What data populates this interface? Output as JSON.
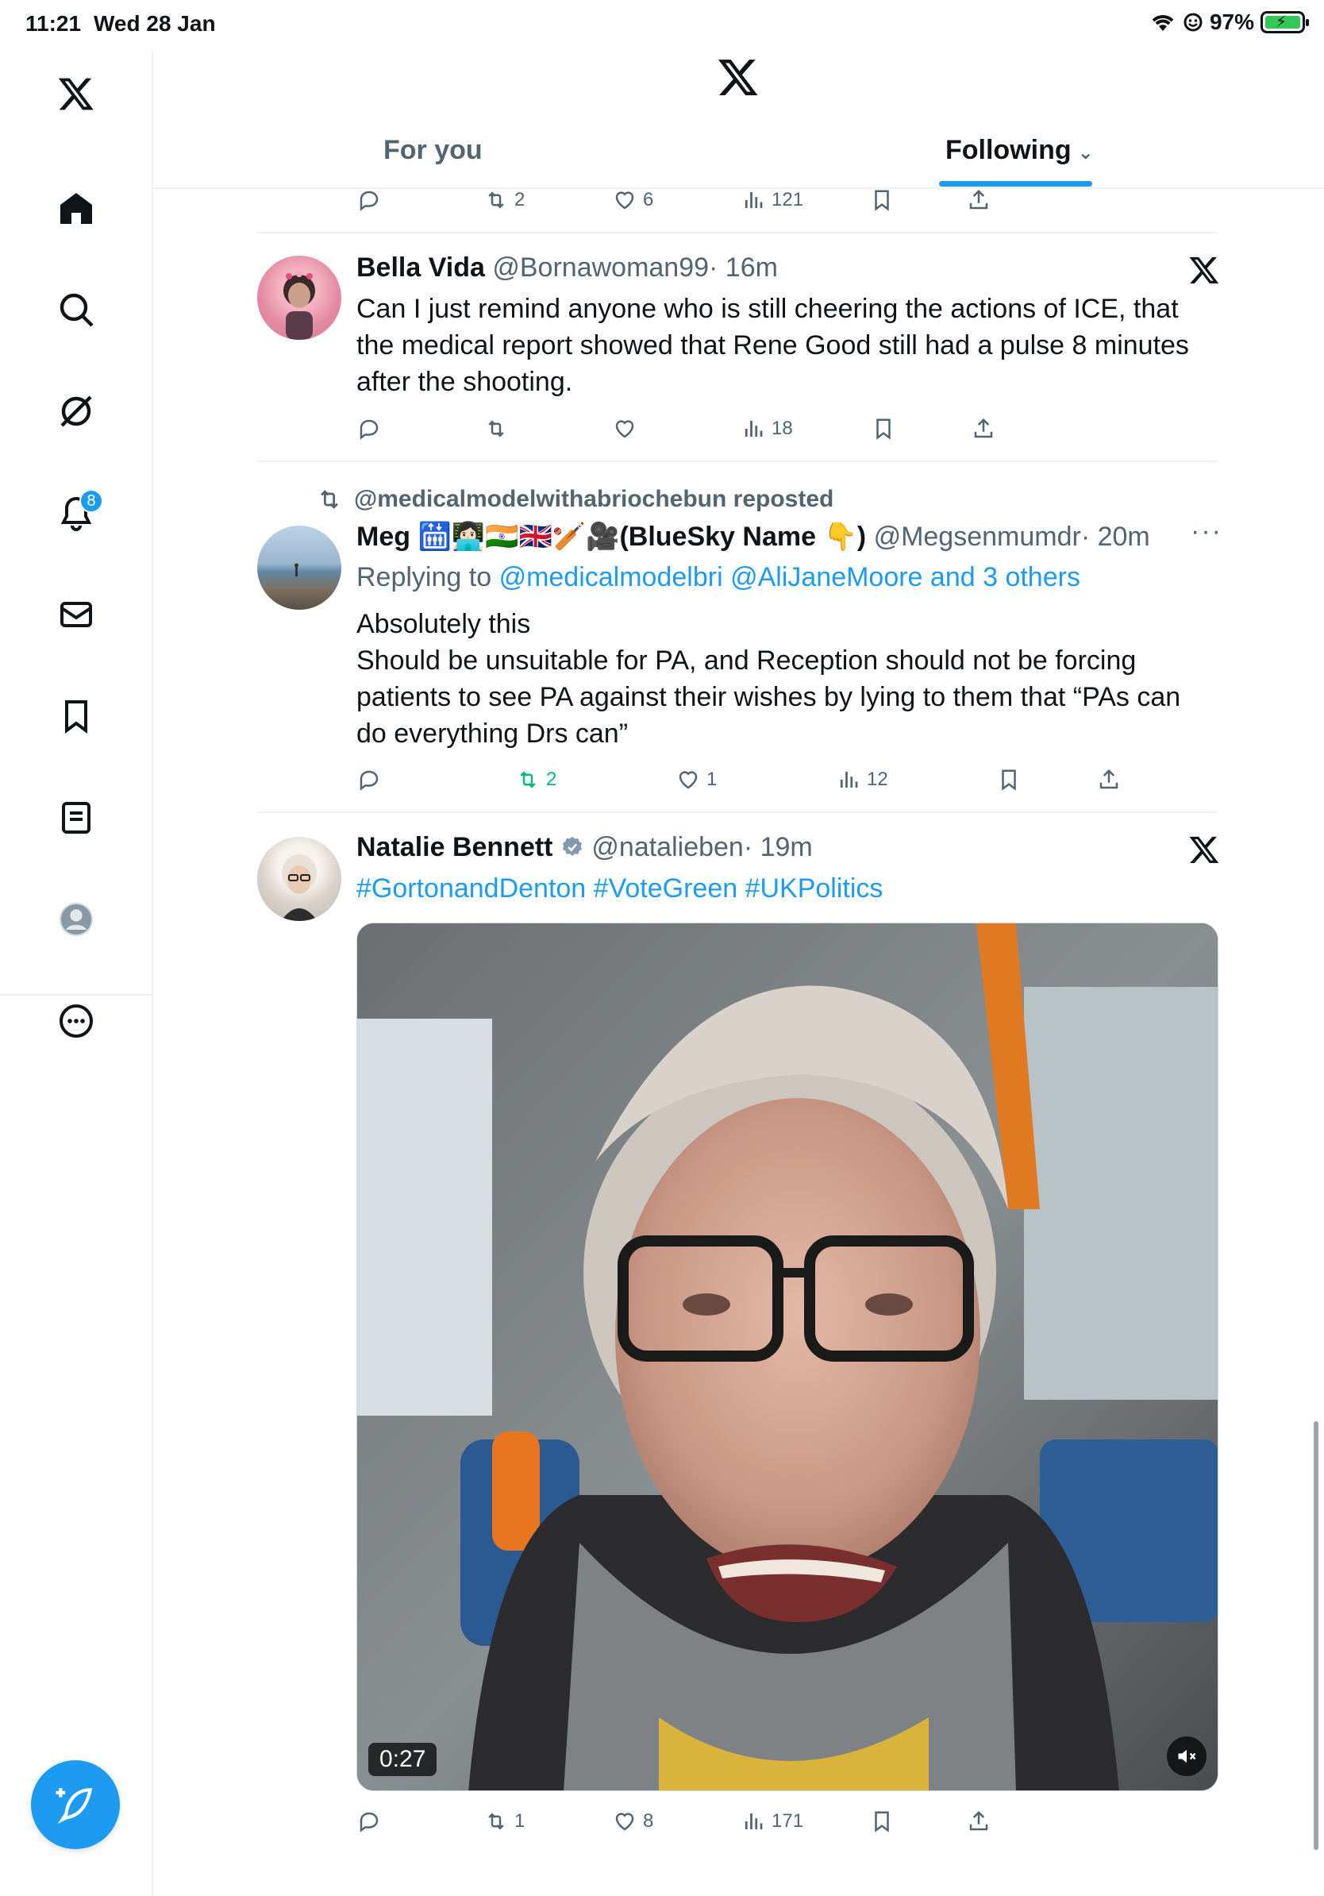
{
  "status_bar": {
    "time": "11:21",
    "date": "Wed 28 Jan",
    "battery": "97%"
  },
  "sidebar": {
    "notifications_badge": "8",
    "items": [
      "x-logo",
      "home",
      "search",
      "grok",
      "notifications",
      "messages",
      "bookmarks",
      "lists",
      "profile",
      "more"
    ]
  },
  "tabs": {
    "for_you": "For you",
    "following": "Following"
  },
  "feed": {
    "top_partial": {
      "reply": "",
      "reposts": "2",
      "likes": "6",
      "views": "121"
    },
    "tweets": [
      {
        "name": "Bella Vida",
        "handle": "@Bornawoman99",
        "time": "· 16m",
        "text": "Can I just remind anyone who is still cheering the actions of ICE, that the medical report showed that Rene Good still had a pulse 8 minutes after the shooting.",
        "reposts": "",
        "likes": "",
        "views": "18"
      },
      {
        "reposted_by": "@medicalmodelwithabriochebun reposted",
        "name": "Meg 🛗👩🏻‍💻🇮🇳🇬🇧🏏🎥(BlueSky Name 👇)",
        "handle": "@Megsenmumdr",
        "time": "· 20m",
        "replying_prefix": "Replying to",
        "replying_to": "@medicalmodelbri @AliJaneMoore and 3 others",
        "text_line1": "Absolutely this",
        "text_line2": "Should be unsuitable for PA, and Reception should not be forcing patients to see PA against their wishes by lying to them that “PAs can do everything Drs can”",
        "reposts": "2",
        "likes": "1",
        "views": "12"
      },
      {
        "name": "Natalie Bennett",
        "handle": "@natalieben",
        "time": "· 19m",
        "hashtags": "#GortonandDenton #VoteGreen #UKPolitics",
        "video_duration": "0:27",
        "reposts": "1",
        "likes": "8",
        "views": "171"
      }
    ]
  },
  "colors": {
    "accent": "#1d9bf0",
    "repost_green": "#00ba7c",
    "secondary_text": "#536471"
  }
}
